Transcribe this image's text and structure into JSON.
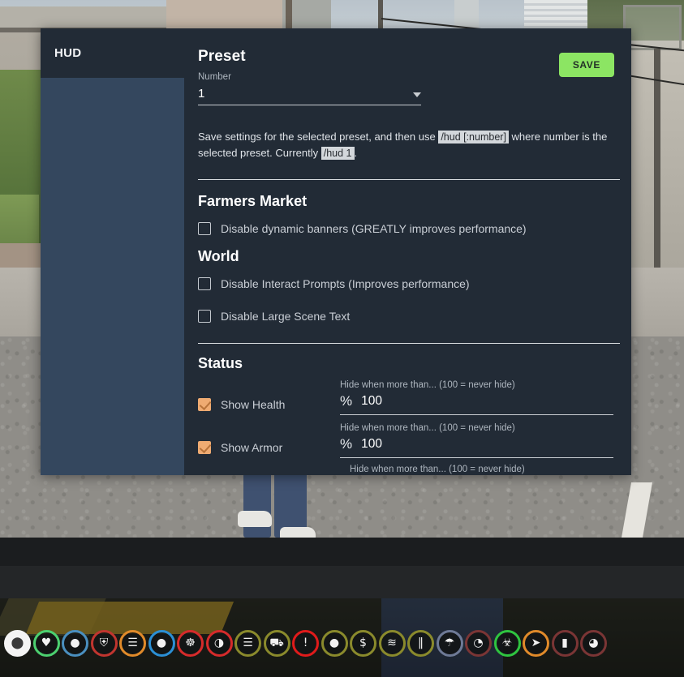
{
  "dialog": {
    "sidebar": {
      "title": "HUD"
    },
    "preset": {
      "heading": "Preset",
      "number_label": "Number",
      "number_value": "1",
      "save_label": "SAVE",
      "help_prefix": "Save settings for the selected preset, and then use",
      "help_code_1": "/hud [:number]",
      "help_middle": "where number is the selected preset. Currently",
      "help_code_2": "/hud 1",
      "help_suffix": "."
    },
    "groups": [
      {
        "title": "Farmers Market",
        "options": [
          {
            "label": "Disable dynamic banners (GREATLY improves performance)",
            "checked": false
          }
        ]
      },
      {
        "title": "World",
        "options": [
          {
            "label": "Disable Interact Prompts (Improves performance)",
            "checked": false
          },
          {
            "label": "Disable Large Scene Text",
            "checked": false
          }
        ]
      }
    ],
    "status": {
      "title": "Status",
      "hide_label": "Hide when more than... (100 = never hide)",
      "percent_symbol": "%",
      "rows": [
        {
          "label": "Show Health",
          "checked": true,
          "value": "100"
        },
        {
          "label": "Show Armor",
          "checked": true,
          "value": "100"
        }
      ]
    }
  },
  "hud_bar": {
    "icons": [
      {
        "name": "microphone-icon",
        "glyph": "Ἲ4",
        "char": "⬤",
        "color": "#f4f4f4",
        "style": "filled"
      },
      {
        "name": "heart-icon",
        "char": "♥",
        "color": "#4cd070"
      },
      {
        "name": "water-drop-icon",
        "char": "●",
        "color": "#4a8fbf"
      },
      {
        "name": "shield-icon",
        "char": "⛨",
        "color": "#c0352f"
      },
      {
        "name": "food-icon",
        "char": "☰",
        "color": "#e08a2a"
      },
      {
        "name": "thirst-drop-icon",
        "char": "●",
        "color": "#2b8fd4"
      },
      {
        "name": "lungs-icon",
        "char": "☸",
        "color": "#d62b2b"
      },
      {
        "name": "brain-icon",
        "char": "◑",
        "color": "#d62b2b"
      },
      {
        "name": "stack-icon",
        "char": "☰",
        "color": "#8a8a2c"
      },
      {
        "name": "stamina-bike-icon",
        "char": "⛟",
        "color": "#8a8a2c"
      },
      {
        "name": "alert-icon",
        "char": "!",
        "color": "#e01b1b"
      },
      {
        "name": "lightbulb-icon",
        "char": "●",
        "color": "#8a8a2c"
      },
      {
        "name": "money-icon",
        "char": "$",
        "color": "#8a8a2c"
      },
      {
        "name": "swimmer-icon",
        "char": "≋",
        "color": "#8a8a2c"
      },
      {
        "name": "dumbbell-icon",
        "char": "‖",
        "color": "#8a8a2c"
      },
      {
        "name": "parachute-icon",
        "char": "☂",
        "color": "#6e7a96"
      },
      {
        "name": "speedometer-icon",
        "char": "◔",
        "color": "#7a3535"
      },
      {
        "name": "biohazard-icon",
        "char": "☣",
        "color": "#2fc440"
      },
      {
        "name": "navigation-icon",
        "char": "➤",
        "color": "#e08a2a"
      },
      {
        "name": "battery-icon",
        "char": "▮",
        "color": "#7a3535"
      },
      {
        "name": "fuel-icon",
        "char": "◕",
        "color": "#7a3535"
      }
    ]
  }
}
